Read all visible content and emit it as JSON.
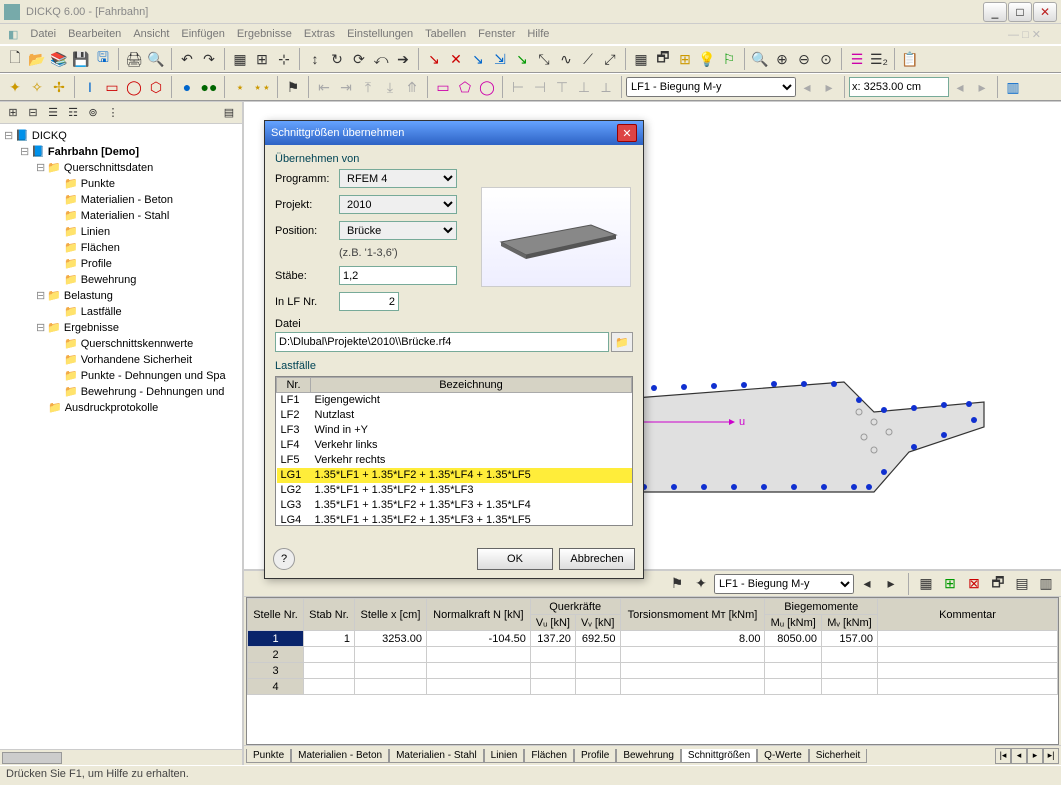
{
  "window": {
    "title": "DICKQ 6.00 - [Fahrbahn]"
  },
  "menu": [
    "Datei",
    "Bearbeiten",
    "Ansicht",
    "Einfügen",
    "Ergebnisse",
    "Extras",
    "Einstellungen",
    "Tabellen",
    "Fenster",
    "Hilfe"
  ],
  "toolbar2": {
    "combo1": "LF1 - Biegung M-y",
    "coord": "x: 3253.00 cm"
  },
  "tree": {
    "root": "DICKQ",
    "project": "Fahrbahn [Demo]",
    "nodes": [
      {
        "label": "Querschnittsdaten",
        "children": [
          "Punkte",
          "Materialien - Beton",
          "Materialien - Stahl",
          "Linien",
          "Flächen",
          "Profile",
          "Bewehrung"
        ]
      },
      {
        "label": "Belastung",
        "children": [
          "Lastfälle"
        ]
      },
      {
        "label": "Ergebnisse",
        "children": [
          "Querschnittskennwerte",
          "Vorhandene Sicherheit",
          "Punkte - Dehnungen und Spa",
          "Bewehrung - Dehnungen und"
        ]
      },
      {
        "label": "Ausdruckprotokolle",
        "children": []
      }
    ]
  },
  "dialog": {
    "title": "Schnittgrößen übernehmen",
    "group1": "Übernehmen von",
    "program_label": "Programm:",
    "program": "RFEM 4",
    "projekt_label": "Projekt:",
    "projekt": "2010",
    "position_label": "Position:",
    "position": "Brücke",
    "hint": "(z.B. '1-3,6')",
    "staebe_label": "Stäbe:",
    "staebe": "1,2",
    "inlfnr_label": "In LF Nr.",
    "inlfnr": "2",
    "datei_label": "Datei",
    "file": "D:\\Dlubal\\Projekte\\2010\\\\Brücke.rf4",
    "group2": "Lastfälle",
    "lf_head_nr": "Nr.",
    "lf_head_bez": "Bezeichnung",
    "lf_rows": [
      {
        "nr": "LF1",
        "bez": "Eigengewicht"
      },
      {
        "nr": "LF2",
        "bez": "Nutzlast"
      },
      {
        "nr": "LF3",
        "bez": "Wind in +Y"
      },
      {
        "nr": "LF4",
        "bez": "Verkehr links"
      },
      {
        "nr": "LF5",
        "bez": "Verkehr rechts"
      },
      {
        "nr": "LG1",
        "bez": "1.35*LF1 + 1.35*LF2 + 1.35*LF4 + 1.35*LF5",
        "sel": true
      },
      {
        "nr": "LG2",
        "bez": "1.35*LF1 + 1.35*LF2 + 1.35*LF3"
      },
      {
        "nr": "LG3",
        "bez": "1.35*LF1 + 1.35*LF2 + 1.35*LF3 + 1.35*LF4"
      },
      {
        "nr": "LG4",
        "bez": "1.35*LF1 + 1.35*LF2 + 1.35*LF3 + 1.35*LF5"
      }
    ],
    "ok": "OK",
    "cancel": "Abbrechen"
  },
  "grid_toolbar": {
    "combo": "LF1 - Biegung M-y"
  },
  "grid": {
    "headers": {
      "stelle_nr": "Stelle\nNr.",
      "stab_nr": "Stab\nNr.",
      "stelle_x": "Stelle\nx [cm]",
      "normalkraft": "Normalkraft\nN [kN]",
      "querkraefte": "Querkräfte",
      "vu": "Vᵤ [kN]",
      "vv": "Vᵥ [kN]",
      "torsion": "Torsionsmoment\nMᴛ [kNm]",
      "biege": "Biegemomente",
      "mu": "Mᵤ [kNm]",
      "mv": "Mᵥ [kNm]",
      "komm": "Kommentar"
    },
    "rows": [
      {
        "n": "1",
        "stab": "1",
        "x": "3253.00",
        "N": "-104.50",
        "Vu": "137.20",
        "Vv": "692.50",
        "MT": "8.00",
        "Mu": "8050.00",
        "Mv": "157.00",
        "k": ""
      },
      {
        "n": "2"
      },
      {
        "n": "3"
      },
      {
        "n": "4"
      }
    ],
    "tabs": [
      "Punkte",
      "Materialien - Beton",
      "Materialien - Stahl",
      "Linien",
      "Flächen",
      "Profile",
      "Bewehrung",
      "Schnittgrößen",
      "Q-Werte",
      "Sicherheit"
    ],
    "active_tab": 7
  },
  "status": "Drücken Sie F1, um Hilfe zu erhalten."
}
